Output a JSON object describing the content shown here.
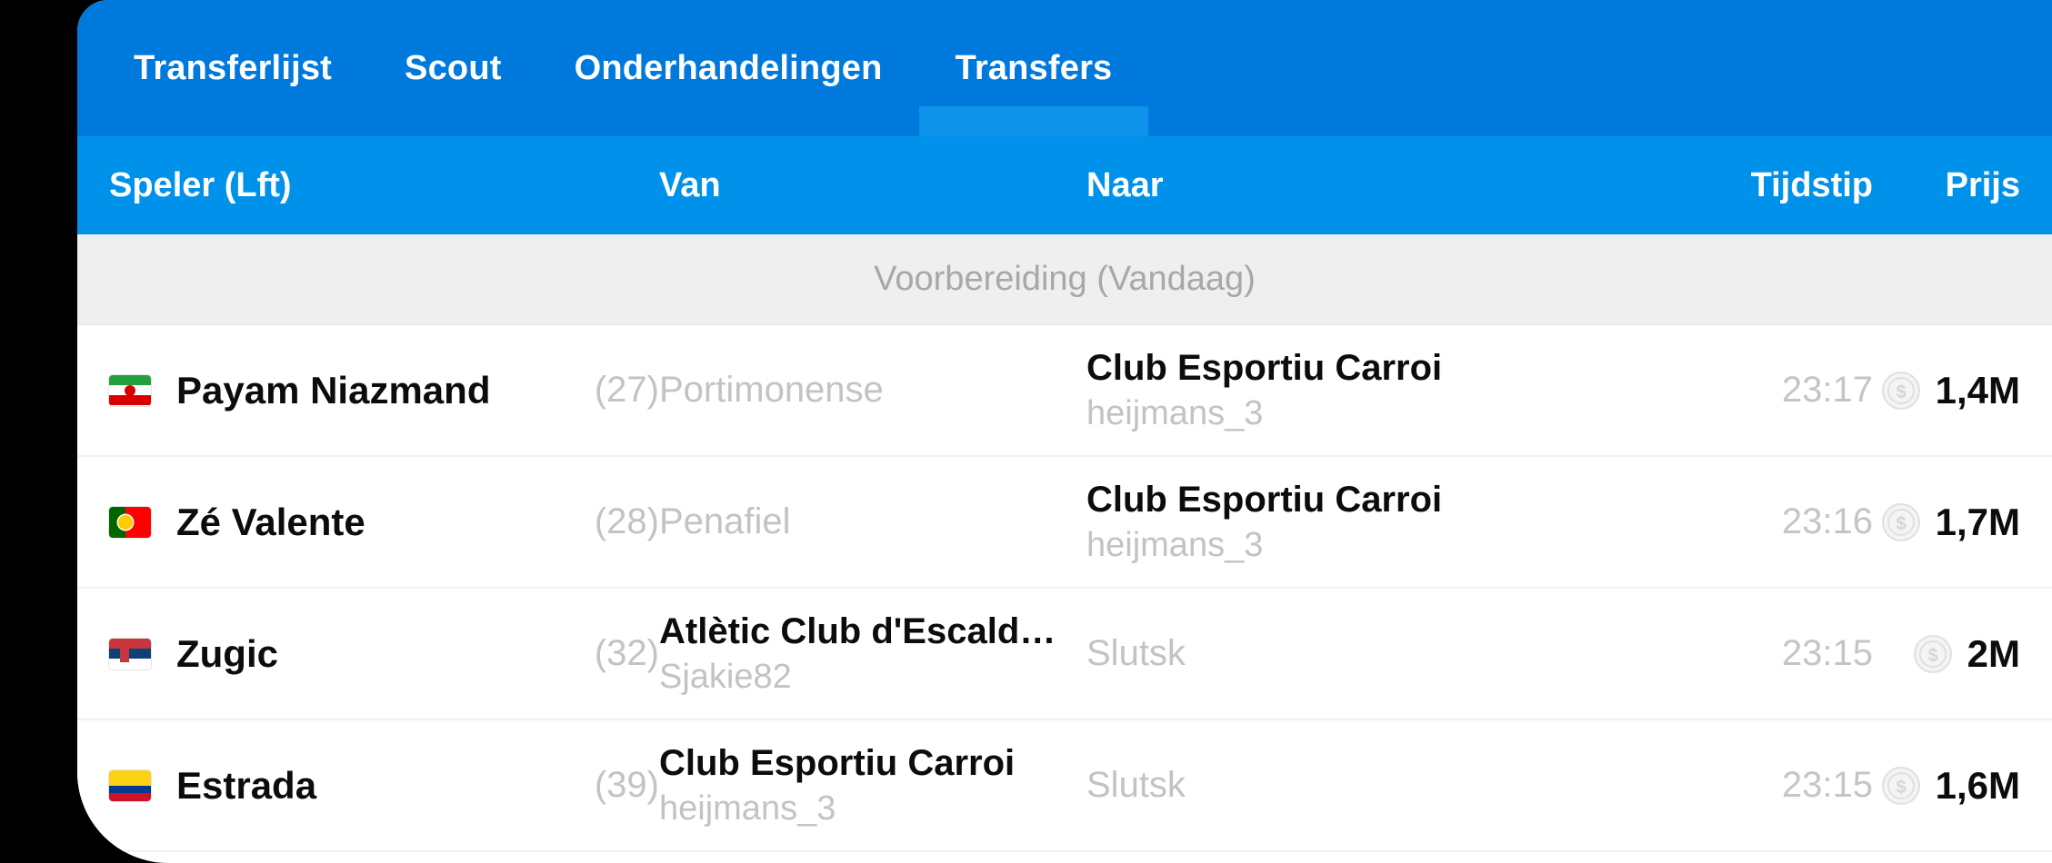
{
  "tabs": [
    {
      "label": "Transferlijst",
      "active": false
    },
    {
      "label": "Scout",
      "active": false
    },
    {
      "label": "Onderhandelingen",
      "active": false
    },
    {
      "label": "Transfers",
      "active": true
    }
  ],
  "columns": {
    "player": "Speler (Lft)",
    "from": "Van",
    "to": "Naar",
    "time": "Tijdstip",
    "price": "Prijs"
  },
  "section": {
    "label": "Voorbereiding (Vandaag)"
  },
  "colors": {
    "tabbar_blue": "#0079dd",
    "header_blue": "#0091ea",
    "active_tab_blue": "#0d93ea",
    "section_gray": "#efefef",
    "muted_text": "#c3c3c3",
    "primary_text": "#0c0c0c"
  },
  "rows": [
    {
      "flag": "iran-flag",
      "player": "Payam Niazmand",
      "age": "(27)",
      "from_club": "Portimonense",
      "from_manager": "",
      "from_bold": false,
      "to_club": "Club Esportiu Carroi",
      "to_manager": "heijmans_3",
      "to_bold": true,
      "time": "23:17",
      "price": "1,4M"
    },
    {
      "flag": "portugal-flag",
      "player": "Zé Valente",
      "age": "(28)",
      "from_club": "Penafiel",
      "from_manager": "",
      "from_bold": false,
      "to_club": "Club Esportiu Carroi",
      "to_manager": "heijmans_3",
      "to_bold": true,
      "time": "23:16",
      "price": "1,7M"
    },
    {
      "flag": "serbia-flag",
      "player": "Zugic",
      "age": "(32)",
      "from_club": "Atlètic Club d'Escald…",
      "from_manager": "Sjakie82",
      "from_bold": true,
      "to_club": "Slutsk",
      "to_manager": "",
      "to_bold": false,
      "time": "23:15",
      "price": "2M"
    },
    {
      "flag": "colombia-flag",
      "player": "Estrada",
      "age": "(39)",
      "from_club": "Club Esportiu Carroi",
      "from_manager": "heijmans_3",
      "from_bold": true,
      "to_club": "Slutsk",
      "to_manager": "",
      "to_bold": false,
      "time": "23:15",
      "price": "1,6M"
    }
  ]
}
